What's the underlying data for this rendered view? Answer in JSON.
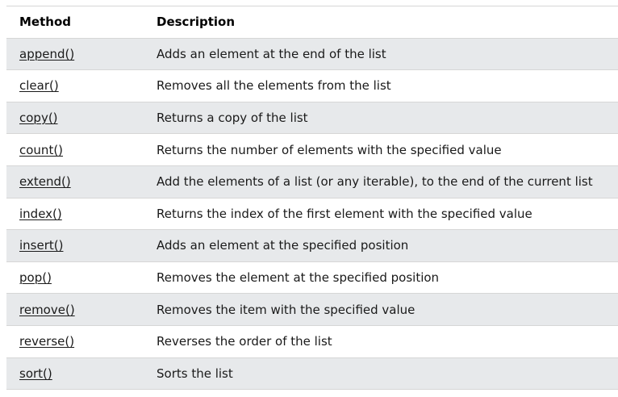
{
  "table": {
    "headers": [
      "Method",
      "Description"
    ],
    "rows": [
      {
        "method": "append()",
        "description": "Adds an element at the end of the list"
      },
      {
        "method": "clear()",
        "description": "Removes all the elements from the list"
      },
      {
        "method": "copy()",
        "description": "Returns a copy of the list"
      },
      {
        "method": "count()",
        "description": "Returns the number of elements with the specified value"
      },
      {
        "method": "extend()",
        "description": "Add the elements of a list (or any iterable), to the end of the current list"
      },
      {
        "method": "index()",
        "description": "Returns the index of the first element with the specified value"
      },
      {
        "method": "insert()",
        "description": "Adds an element at the specified position"
      },
      {
        "method": "pop()",
        "description": "Removes the element at the specified position"
      },
      {
        "method": "remove()",
        "description": "Removes the item with the specified value"
      },
      {
        "method": "reverse()",
        "description": "Reverses the order of the list"
      },
      {
        "method": "sort()",
        "description": "Sorts the list"
      }
    ]
  },
  "colors": {
    "stripe": "#e7e9eb",
    "border": "#d6d6d6",
    "text": "#1a1a1a"
  }
}
